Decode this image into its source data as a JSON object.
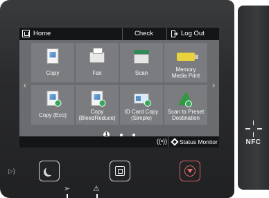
{
  "header": {
    "title": "Home",
    "check_counter": "Check Counter",
    "logout": "Log Out"
  },
  "tiles": [
    {
      "label": "Copy",
      "icon": "copy-icon"
    },
    {
      "label": "Fax",
      "icon": "fax-icon"
    },
    {
      "label": "Scan",
      "icon": "scan-icon"
    },
    {
      "label": "Memory\nMedia Print",
      "icon": "memory-media-icon"
    },
    {
      "label": "Copy (Eco)",
      "icon": "copy-eco-icon"
    },
    {
      "label": "Copy\n(BleedReduce)",
      "icon": "copy-bleed-icon"
    },
    {
      "label": "ID Card Copy\n(Simple)",
      "icon": "id-card-icon"
    },
    {
      "label": "Scan to Preset\nDestination",
      "icon": "scan-preset-icon"
    }
  ],
  "pager": {
    "current": "1",
    "total_pages": 3
  },
  "status": {
    "monitor": "Status Monitor",
    "wifi": "wireless-icon"
  },
  "side_panel": {
    "label": "NFC"
  },
  "colors": {
    "screen_bg": "#6e7074",
    "tile_bg": "#7a7c80",
    "bar_bg": "#141516",
    "stop_red": "#e06060"
  }
}
